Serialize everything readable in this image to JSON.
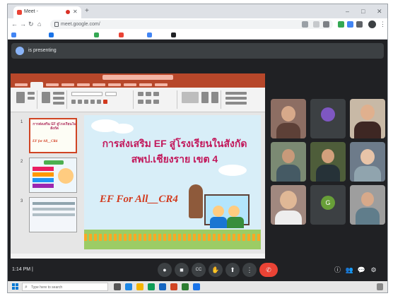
{
  "browser": {
    "tab_title": "Meet - ",
    "new_tab": "+",
    "url": "meet.google.com/",
    "bookmarks": [
      "",
      "",
      "",
      "",
      "",
      ""
    ],
    "window_controls": [
      "–",
      "□",
      "✕"
    ]
  },
  "meet": {
    "presenting_banner": "is presenting",
    "clock": "1:14 PM",
    "separator": "|",
    "participants": [
      {
        "name": ""
      },
      {
        "name": ""
      },
      {
        "name": ""
      },
      {
        "name": ""
      },
      {
        "name": ""
      },
      {
        "name": ""
      },
      {
        "name": ""
      },
      {
        "name": ""
      },
      {
        "name": ""
      }
    ],
    "tile_avatar": "G",
    "controls": {
      "mic": "●",
      "camera": "■",
      "captions": "CC",
      "hand": "✋",
      "present": "⬆",
      "more": "⋮",
      "end_call": "✆"
    },
    "right_controls": [
      "ⓘ",
      "👥",
      "💬",
      "⚙"
    ]
  },
  "powerpoint": {
    "thumb_title": "การส่งเสริม EF สู่โรงเรียนในสังกัด",
    "thumb_subtitle": "EF  for  All__CR4",
    "thumb_numbers": [
      "1",
      "2",
      "3"
    ],
    "slide": {
      "line1": "การส่งเสริม EF สู่โรงเรียนในสังกัด",
      "line2": "สพป.เชียงราย เขต 4",
      "subtitle": "EF For All__CR4"
    }
  },
  "taskbar": {
    "search_placeholder": "Type here to search",
    "tray_text": ""
  },
  "colors": {
    "meet_bg": "#202124",
    "ppt_accent": "#b7472a",
    "end_call": "#ea4335",
    "slide_title": "#c2185b",
    "slide_subtitle": "#d23a1e"
  },
  "icons": [
    "windows-start-icon",
    "search-icon",
    "lock-icon",
    "mic-icon",
    "camera-icon",
    "captions-icon",
    "raise-hand-icon",
    "present-icon",
    "more-options-icon",
    "end-call-icon",
    "info-icon",
    "people-icon",
    "chat-icon",
    "activities-icon"
  ]
}
